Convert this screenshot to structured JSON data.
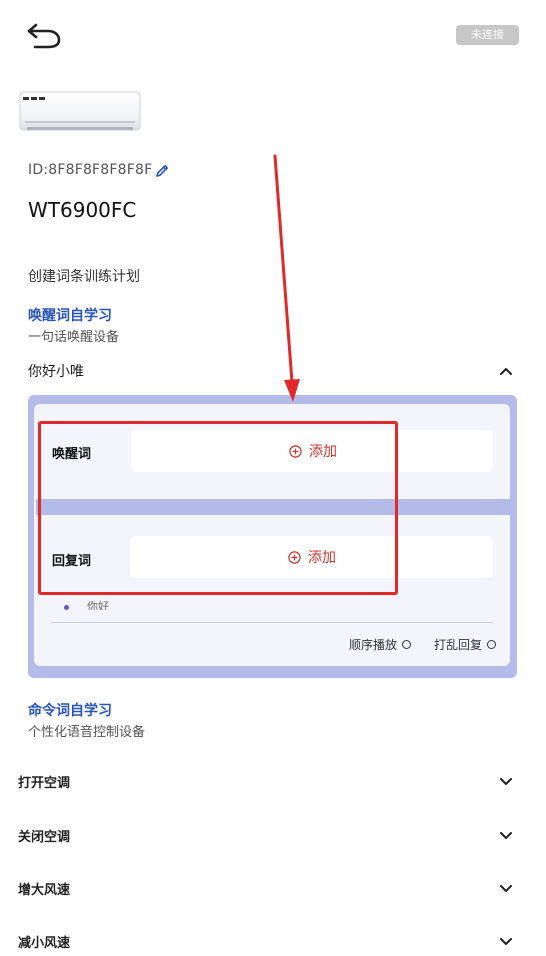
{
  "header": {
    "back_icon": "back-arrow-icon",
    "status_label": "未连接"
  },
  "device": {
    "id_label": "ID:8F8F8F8F8F8F",
    "model": "WT6900FC",
    "image": "air-conditioner-unit"
  },
  "plan_title": "创建词条训练计划",
  "wake_section": {
    "title": "唤醒词自学习",
    "subtitle": "一句话唤醒设备",
    "wake_word": "你好小唯",
    "expanded": true,
    "wake_label": "唤醒词",
    "reply_label": "回复词",
    "add_label": "添加",
    "reply_item": "你好",
    "options": {
      "sequential": "顺序播放",
      "shuffle": "打乱回复"
    }
  },
  "command_section": {
    "title": "命令词自学习",
    "subtitle": "个性化语音控制设备",
    "items": [
      "打开空调",
      "关闭空调",
      "增大风速",
      "减小风速"
    ]
  },
  "colors": {
    "accent_blue": "#2a55b8",
    "panel_purple": "#b3bce9",
    "add_red": "#d0332f",
    "highlight_red": "#e02a2a",
    "badge_gray": "#c7c7c7"
  }
}
